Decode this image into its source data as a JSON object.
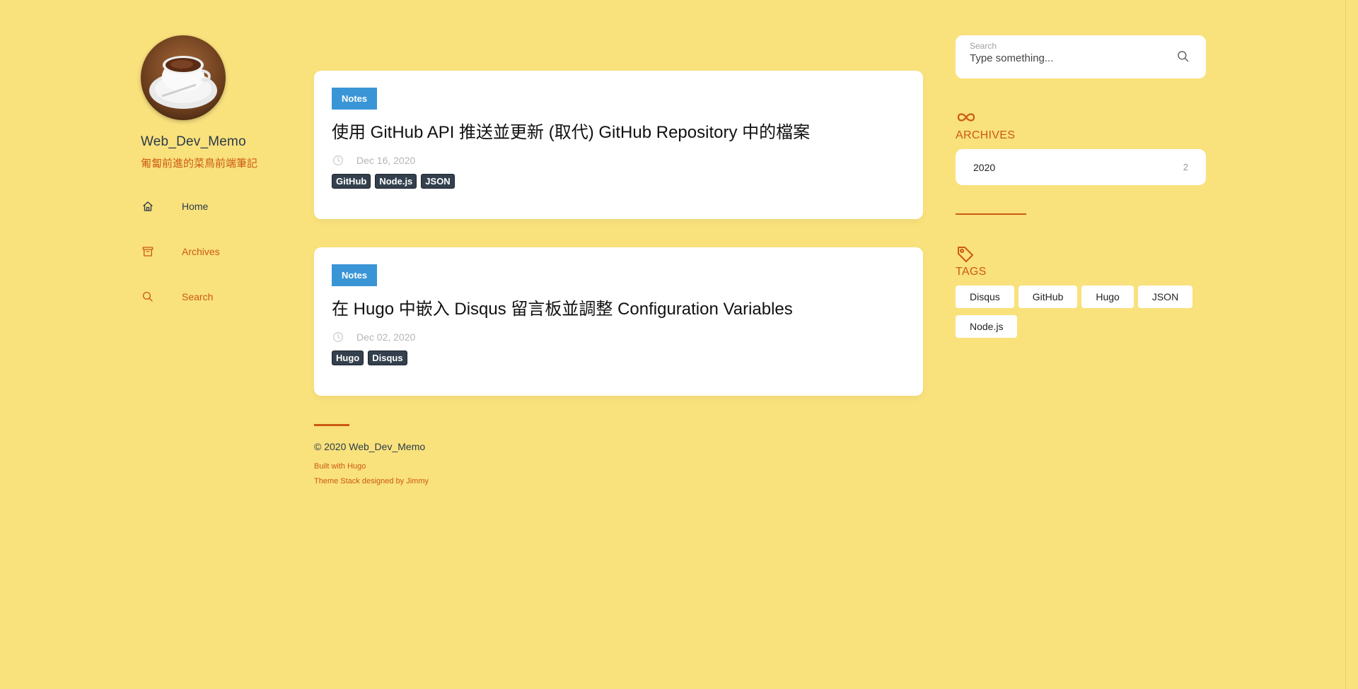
{
  "site": {
    "name": "Web_Dev_Memo",
    "description": "匍匐前進的菜鳥前端筆記"
  },
  "menu": [
    {
      "label": "Home",
      "icon": "home-icon"
    },
    {
      "label": "Archives",
      "icon": "archive-box-icon"
    },
    {
      "label": "Search",
      "icon": "search-icon"
    }
  ],
  "posts": [
    {
      "category": "Notes",
      "title": "使用 GitHub API 推送並更新 (取代) GitHub Repository 中的檔案",
      "date": "Dec 16, 2020",
      "tags": [
        "GitHub",
        "Node.js",
        "JSON"
      ]
    },
    {
      "category": "Notes",
      "title": "在 Hugo 中嵌入 Disqus 留言板並調整 Configuration Variables",
      "date": "Dec 02, 2020",
      "tags": [
        "Hugo",
        "Disqus"
      ]
    }
  ],
  "footer": {
    "copyright": "© 2020 Web_Dev_Memo",
    "built_with": "Built with Hugo",
    "theme": "Theme Stack designed by Jimmy"
  },
  "search": {
    "label": "Search",
    "placeholder": "Type something..."
  },
  "archives": {
    "title": "ARCHIVES",
    "items": [
      {
        "year": "2020",
        "count": "2"
      }
    ]
  },
  "tags_widget": {
    "title": "TAGS",
    "tags": [
      "Disqus",
      "GitHub",
      "Hugo",
      "JSON",
      "Node.js"
    ]
  },
  "colors": {
    "background": "#f9e17c",
    "accent": "#cc5a10",
    "category": "#3a95d6",
    "tag_chip": "#34404d"
  }
}
